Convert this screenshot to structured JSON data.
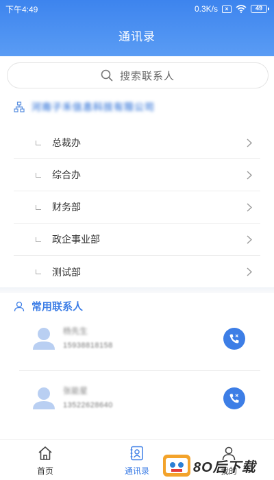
{
  "status_bar": {
    "time": "下午4:49",
    "speed": "0.3K/s",
    "battery": "49"
  },
  "header": {
    "title": "通讯录"
  },
  "search": {
    "placeholder": "搜索联系人"
  },
  "organization": {
    "name": "河南子禾信息科技有限公司"
  },
  "departments": [
    {
      "label": "总裁办"
    },
    {
      "label": "综合办"
    },
    {
      "label": "财务部"
    },
    {
      "label": "政企事业部"
    },
    {
      "label": "测试部"
    }
  ],
  "frequent": {
    "title": "常用联系人",
    "contacts": [
      {
        "name": "杨先生",
        "phone": "15938818158"
      },
      {
        "name": "张能星",
        "phone": "13522628640"
      }
    ]
  },
  "tabbar": {
    "tabs": [
      {
        "label": "首页",
        "icon": "home-icon"
      },
      {
        "label": "通讯录",
        "icon": "contacts-icon"
      },
      {
        "label": "我的",
        "icon": "profile-icon"
      }
    ]
  },
  "watermark": {
    "text": "8O后下载"
  },
  "colors": {
    "accent": "#3d7ee6",
    "header": "#4a8ff0"
  }
}
